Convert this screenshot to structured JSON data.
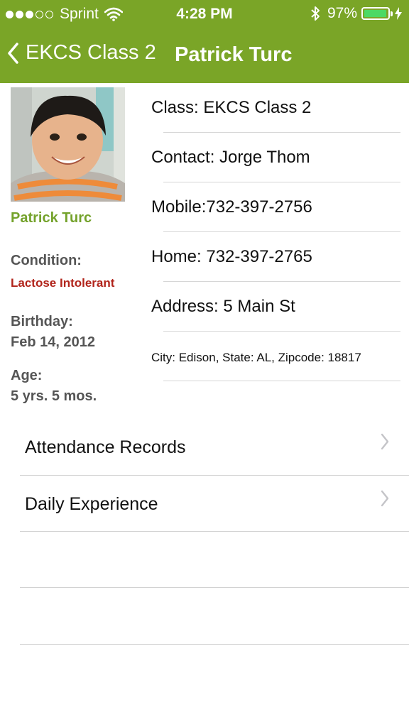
{
  "status_bar": {
    "carrier": "Sprint",
    "time": "4:28 PM",
    "battery_percent": "97%",
    "battery_level": 0.97,
    "signal_bars_filled": 3,
    "signal_bars_total": 5
  },
  "nav": {
    "back_label": "EKCS Class 2",
    "title": "Patrick Turc"
  },
  "profile": {
    "name": "Patrick Turc",
    "condition_label": "Condition:",
    "condition_value": "Lactose Intolerant",
    "birthday_label": "Birthday:",
    "birthday_value": "Feb 14, 2012",
    "age_label": "Age:",
    "age_value": "5 yrs. 5 mos."
  },
  "info": {
    "class": "Class: EKCS Class 2",
    "contact": "Contact: Jorge Thom",
    "mobile": "Mobile:732-397-2756",
    "home": "Home: 732-397-2765",
    "address": "Address: 5 Main St",
    "city": "City: Edison, State: AL, Zipcode: 18817"
  },
  "menu": {
    "items": [
      {
        "label": "Attendance Records"
      },
      {
        "label": "Daily Experience"
      }
    ]
  },
  "colors": {
    "brand_green": "#7aa527",
    "name_green": "#74a22b",
    "condition_red": "#b1241b",
    "battery_green": "#4cd964"
  }
}
